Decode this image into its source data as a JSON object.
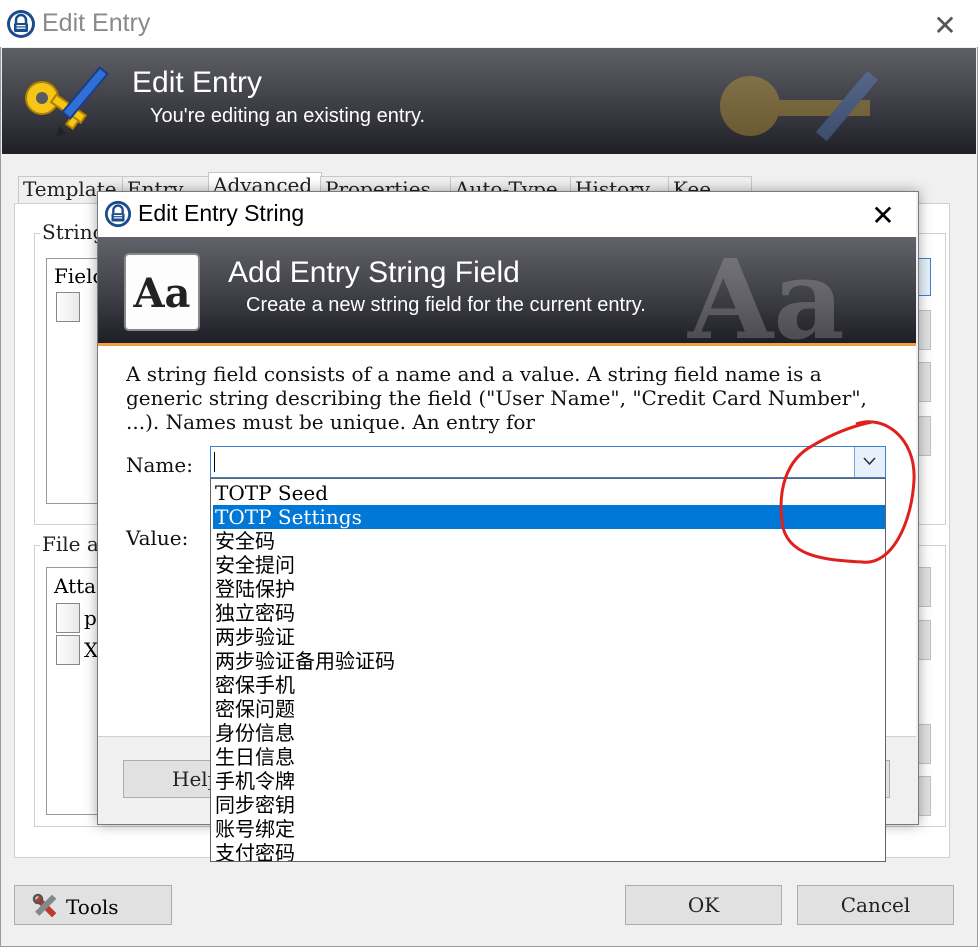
{
  "outer_window": {
    "title": "Edit Entry",
    "close_glyph": "✕",
    "banner_title": "Edit Entry",
    "banner_subtitle": "You're editing an existing entry.",
    "tabs": [
      "Template",
      "Entry",
      "Advanced",
      "Properties",
      "Auto-Type",
      "History",
      "Kee"
    ],
    "selected_tab": "Advanced",
    "strings_group_title": "Strings",
    "strings_list_header": "Field",
    "files_group_title": "File attachments",
    "files_list_header": "Attachments",
    "files_items": [
      "p",
      "X"
    ],
    "tools_label": "Tools",
    "ok_label": "OK",
    "cancel_label": "Cancel"
  },
  "dialog": {
    "title": "Edit Entry String",
    "close_glyph": "✕",
    "banner_title": "Add Entry String Field",
    "banner_subtitle": "Create a new string field for the current entry.",
    "description": "A string field consists of a name and a value. A string field name is a generic string describing the field (\"User Name\", \"Credit Card Number\", ...). Names must be unique. An entry for",
    "name_label": "Name:",
    "name_value": "",
    "value_label": "Value:",
    "help_label": "Help",
    "dropdown_options": [
      "TOTP Seed",
      "TOTP Settings",
      "安全码",
      "安全提问",
      "登陆保护",
      "独立密码",
      "两步验证",
      "两步验证备用验证码",
      "密保手机",
      "密保问题",
      "身份信息",
      "生日信息",
      "手机令牌",
      "同步密钥",
      "账号绑定",
      "支付密码"
    ],
    "selected_option": "TOTP Settings"
  },
  "colors": {
    "selection": "#0078d7",
    "annotation_circle": "#e0201c",
    "banner_dark": "#3a3a42",
    "accent_line": "#f0a040"
  },
  "icons": [
    "lock-icon",
    "key-pencil-icon",
    "font-aa-icon",
    "chevron-down-icon",
    "tools-icon",
    "file-icon"
  ]
}
